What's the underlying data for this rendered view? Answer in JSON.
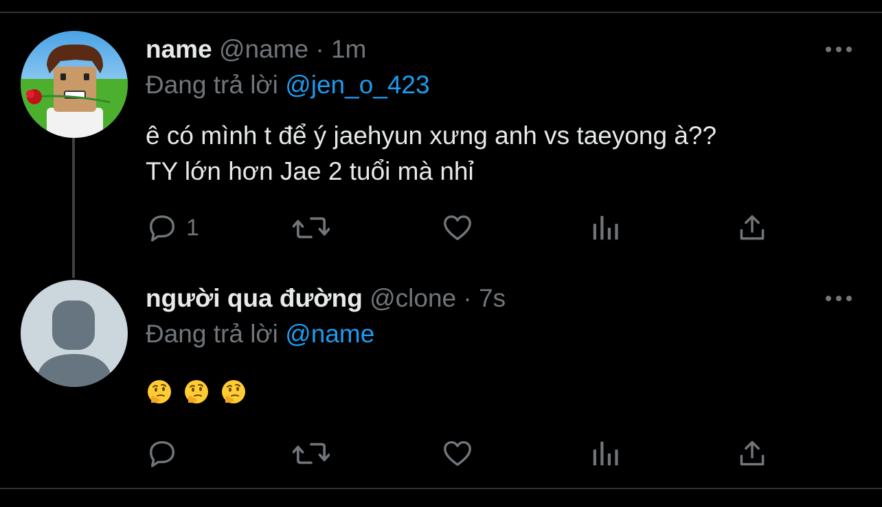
{
  "thread": [
    {
      "display_name": "name",
      "handle": "@name",
      "separator": "·",
      "time": "1m",
      "reply_prefix": "Đang trả lời",
      "reply_to": "@jen_o_423",
      "text_line1": "ê có mình t để ý jaehyun xưng anh vs taeyong à??",
      "text_line2": "TY lớn hơn Jae 2 tuổi mà nhỉ",
      "reply_count": "1",
      "avatar": "roblox-character-with-rose-avatar",
      "colors": {
        "name": "#e7e9ea",
        "meta": "#71767b",
        "mention": "#1d9bf0"
      }
    },
    {
      "display_name": "người qua đường",
      "handle": "@clone",
      "separator": "·",
      "time": "7s",
      "reply_prefix": "Đang trả lời",
      "reply_to": "@name",
      "emojis": [
        "thinking-face",
        "thinking-face",
        "thinking-face"
      ],
      "reply_count": "",
      "avatar": "default-profile-avatar"
    }
  ],
  "icons": [
    "reply-icon",
    "retweet-icon",
    "like-icon",
    "views-icon",
    "share-icon",
    "more-icon"
  ],
  "theme": {
    "background": "#000000",
    "divider": "#2f3336",
    "icon": "#71767b"
  }
}
